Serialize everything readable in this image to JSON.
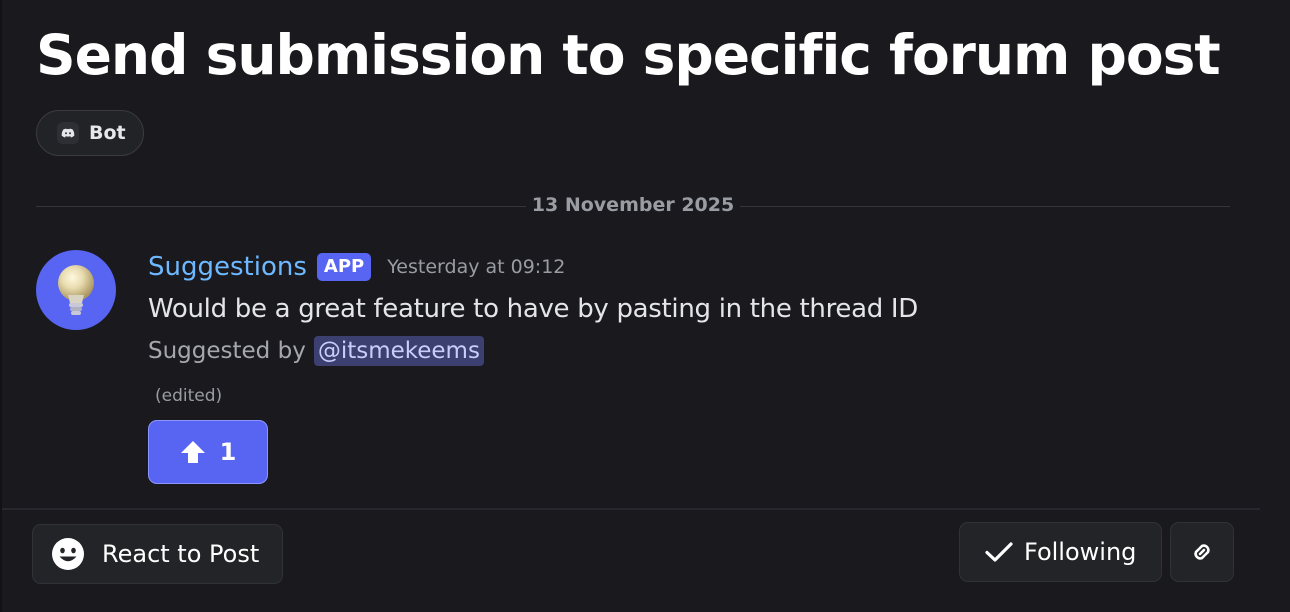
{
  "post": {
    "title": "Send submission to specific forum post",
    "tag": {
      "label": "Bot",
      "icon": "discord-icon"
    }
  },
  "divider": {
    "date": "13 November 2025"
  },
  "message": {
    "author": "Suggestions",
    "badge": "APP",
    "timestamp": "Yesterday at 09:12",
    "avatar_icon": "lightbulb-icon",
    "content": "Would be a great feature to have by pasting in the thread ID",
    "suggested_by_prefix": "Suggested by",
    "suggested_by_mention": "@itsmekeems",
    "edited": "(edited)",
    "vote": {
      "icon": "arrow-up-icon",
      "count": "1"
    }
  },
  "footer": {
    "react_label": "React to Post",
    "following_label": "Following",
    "link_icon": "link-icon"
  },
  "colors": {
    "background": "#1a1a1e",
    "accent": "#5865f2",
    "author": "#6db8ff",
    "mention_bg": "#3c4070"
  }
}
